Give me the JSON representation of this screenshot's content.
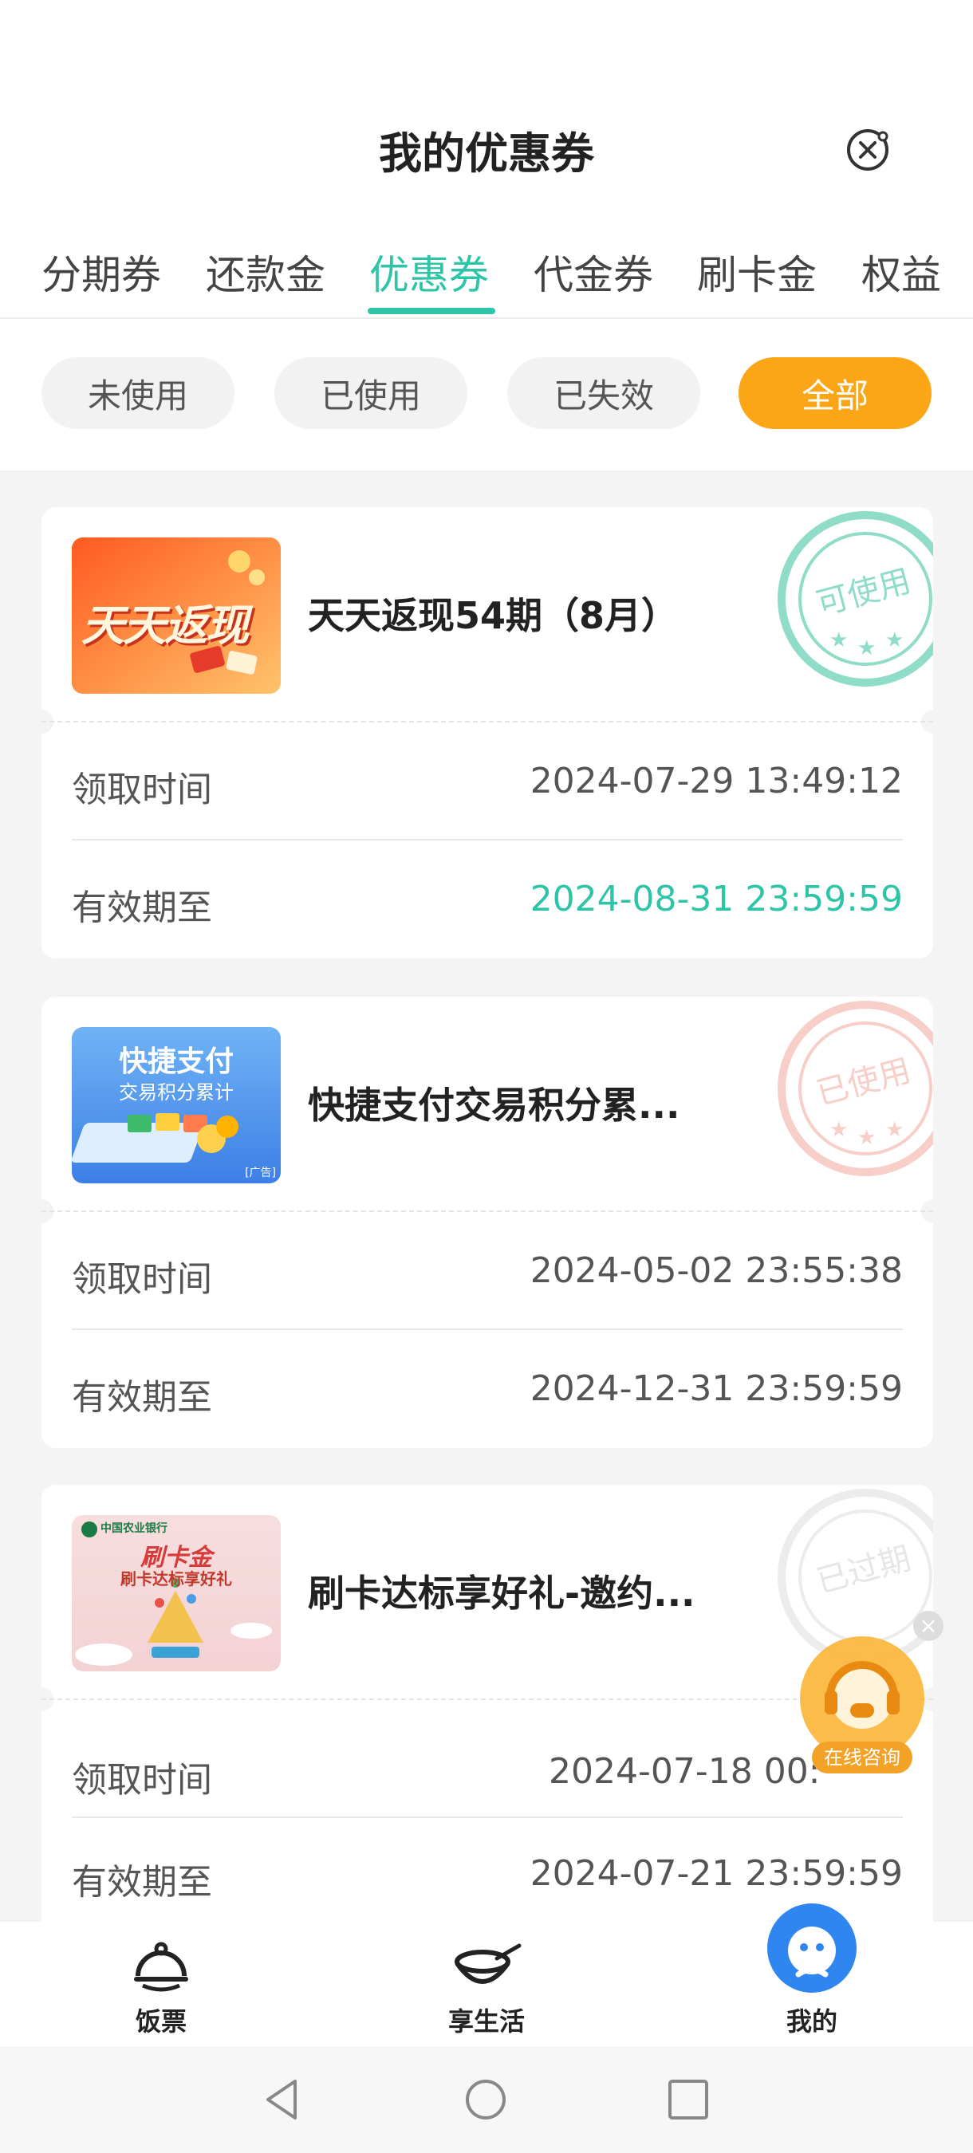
{
  "header": {
    "title": "我的优惠券",
    "close_icon": "close-circle-icon"
  },
  "tabs": [
    {
      "label": "分期券",
      "active": false
    },
    {
      "label": "还款金",
      "active": false
    },
    {
      "label": "优惠券",
      "active": true
    },
    {
      "label": "代金券",
      "active": false
    },
    {
      "label": "刷卡金",
      "active": false
    },
    {
      "label": "权益",
      "active": false
    }
  ],
  "filters": [
    {
      "label": "未使用",
      "active": false
    },
    {
      "label": "已使用",
      "active": false
    },
    {
      "label": "已失效",
      "active": false
    },
    {
      "label": "全部",
      "active": true
    }
  ],
  "coupons": [
    {
      "title": "天天返现54期（8月）",
      "thumb_text": "天天返现",
      "stamp": "可使用",
      "received_label": "领取时间",
      "received_value": "2024-07-29 13:49:12",
      "expire_label": "有效期至",
      "expire_value": "2024-08-31 23:59:59"
    },
    {
      "title": "快捷支付交易积分累...",
      "thumb_text": "快捷支付",
      "thumb_subtext": "交易积分累计",
      "thumb_tag": "[广告]",
      "stamp": "已使用",
      "received_label": "领取时间",
      "received_value": "2024-05-02 23:55:38",
      "expire_label": "有效期至",
      "expire_value": "2024-12-31 23:59:59"
    },
    {
      "title": "刷卡达标享好礼-邀约...",
      "thumb_bank": "中国农业银行",
      "thumb_text": "刷卡金",
      "thumb_subtext": "刷卡达标享好礼",
      "stamp": "已过期",
      "received_label": "领取时间",
      "received_value": "2024-07-18 00:",
      "expire_label": "有效期至",
      "expire_value": "2024-07-21 23:59:59"
    }
  ],
  "floating": {
    "label": "在线咨询",
    "icon": "headset-support-icon"
  },
  "bottom_nav": [
    {
      "label": "饭票",
      "icon": "rice-bowl-icon"
    },
    {
      "label": "享生活",
      "icon": "bowl-chopsticks-icon"
    },
    {
      "label": "我的",
      "icon": "profile-face-icon",
      "active": true
    }
  ],
  "colors": {
    "accent": "#2ec4a7",
    "chip_active": "#fca516",
    "nav_active": "#2f86f0"
  }
}
